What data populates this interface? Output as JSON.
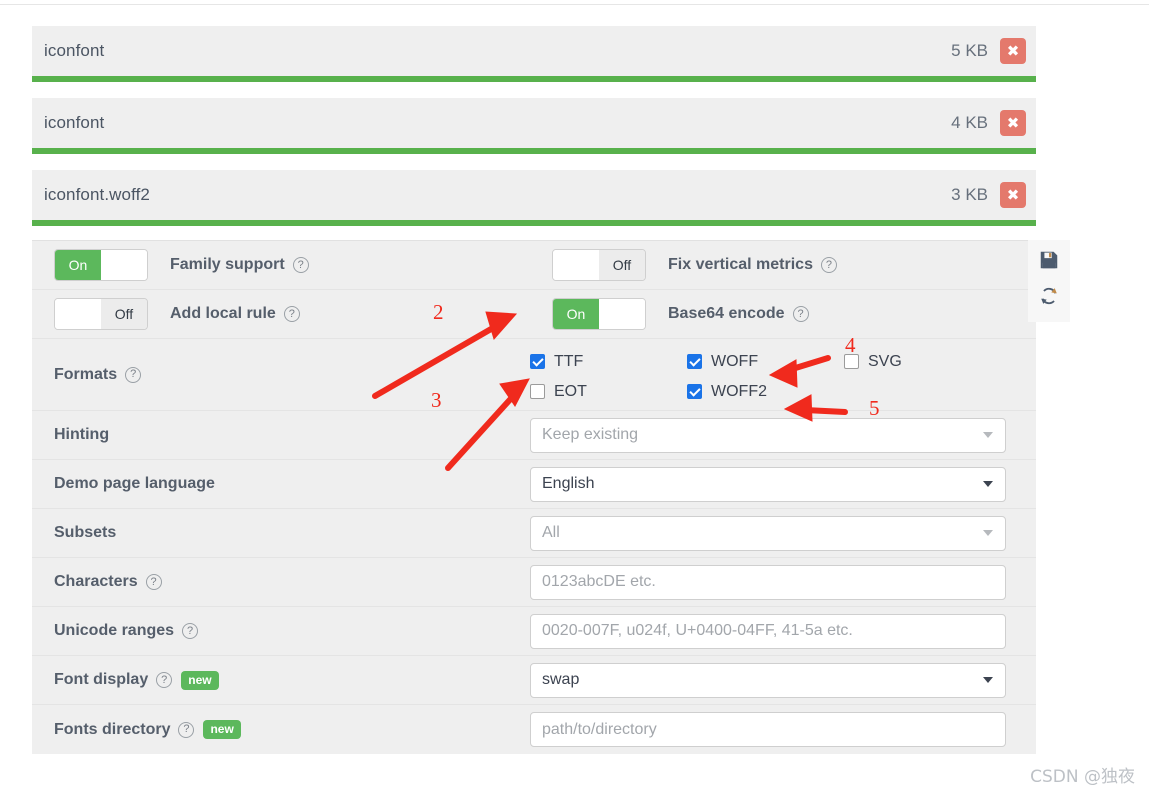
{
  "files": [
    {
      "name": "iconfont",
      "size": "5 KB",
      "delete_icon": "close-icon"
    },
    {
      "name": "iconfont",
      "size": "4 KB",
      "delete_icon": "close-icon"
    },
    {
      "name": "iconfont.woff2",
      "size": "3 KB",
      "delete_icon": "close-icon"
    }
  ],
  "toggles": [
    {
      "state": "On",
      "on_label": "On",
      "off_label": "",
      "label": "Family support",
      "help": "?"
    },
    {
      "state": "Off",
      "on_label": "",
      "off_label": "Off",
      "label": "Fix vertical metrics",
      "help": "?"
    },
    {
      "state": "Off",
      "on_label": "",
      "off_label": "Off",
      "label": "Add local rule",
      "help": "?"
    },
    {
      "state": "On",
      "on_label": "On",
      "off_label": "",
      "label": "Base64 encode",
      "help": "?"
    }
  ],
  "formats": {
    "label": "Formats",
    "help": "?",
    "options": [
      {
        "label": "TTF",
        "checked": true
      },
      {
        "label": "WOFF",
        "checked": true
      },
      {
        "label": "SVG",
        "checked": false
      },
      {
        "label": "EOT",
        "checked": false
      },
      {
        "label": "WOFF2",
        "checked": true
      }
    ]
  },
  "fields": [
    {
      "label": "Hinting",
      "help": false,
      "new": false,
      "value": "Keep existing",
      "kind": "select",
      "placeholder_style": true
    },
    {
      "label": "Demo page language",
      "help": false,
      "new": false,
      "value": "English",
      "kind": "select",
      "placeholder_style": false
    },
    {
      "label": "Subsets",
      "help": false,
      "new": false,
      "value": "All",
      "kind": "select",
      "placeholder_style": true
    },
    {
      "label": "Characters",
      "help": true,
      "new": false,
      "value": "0123abcDE etc.",
      "kind": "input",
      "placeholder_style": true
    },
    {
      "label": "Unicode ranges",
      "help": true,
      "new": false,
      "value": "0020-007F, u024f, U+0400-04FF, 41-5a etc.",
      "kind": "input",
      "placeholder_style": true
    },
    {
      "label": "Font display",
      "help": true,
      "new": true,
      "value": "swap",
      "kind": "select",
      "placeholder_style": false
    },
    {
      "label": "Fonts directory",
      "help": true,
      "new": true,
      "value": "path/to/directory",
      "kind": "input",
      "placeholder_style": true
    }
  ],
  "new_badge_label": "new",
  "help_glyph": "?",
  "side_icons": [
    {
      "name": "save-icon",
      "title": "save"
    },
    {
      "name": "refresh-icon",
      "title": "refresh"
    }
  ],
  "annotations": [
    {
      "number": "2",
      "target": "base64-encode-toggle"
    },
    {
      "number": "3",
      "target": "ttf-checkbox"
    },
    {
      "number": "4",
      "target": "woff-checkbox"
    },
    {
      "number": "5",
      "target": "woff2-checkbox"
    }
  ],
  "watermark": "CSDN @独夜",
  "colors": {
    "green": "#5cb85c",
    "progress_green": "#58b14c",
    "delete_red": "#e4796c",
    "checkbox_blue": "#1a73e8",
    "annotation_red": "#f02a1d",
    "panel_bg": "#efefef"
  }
}
